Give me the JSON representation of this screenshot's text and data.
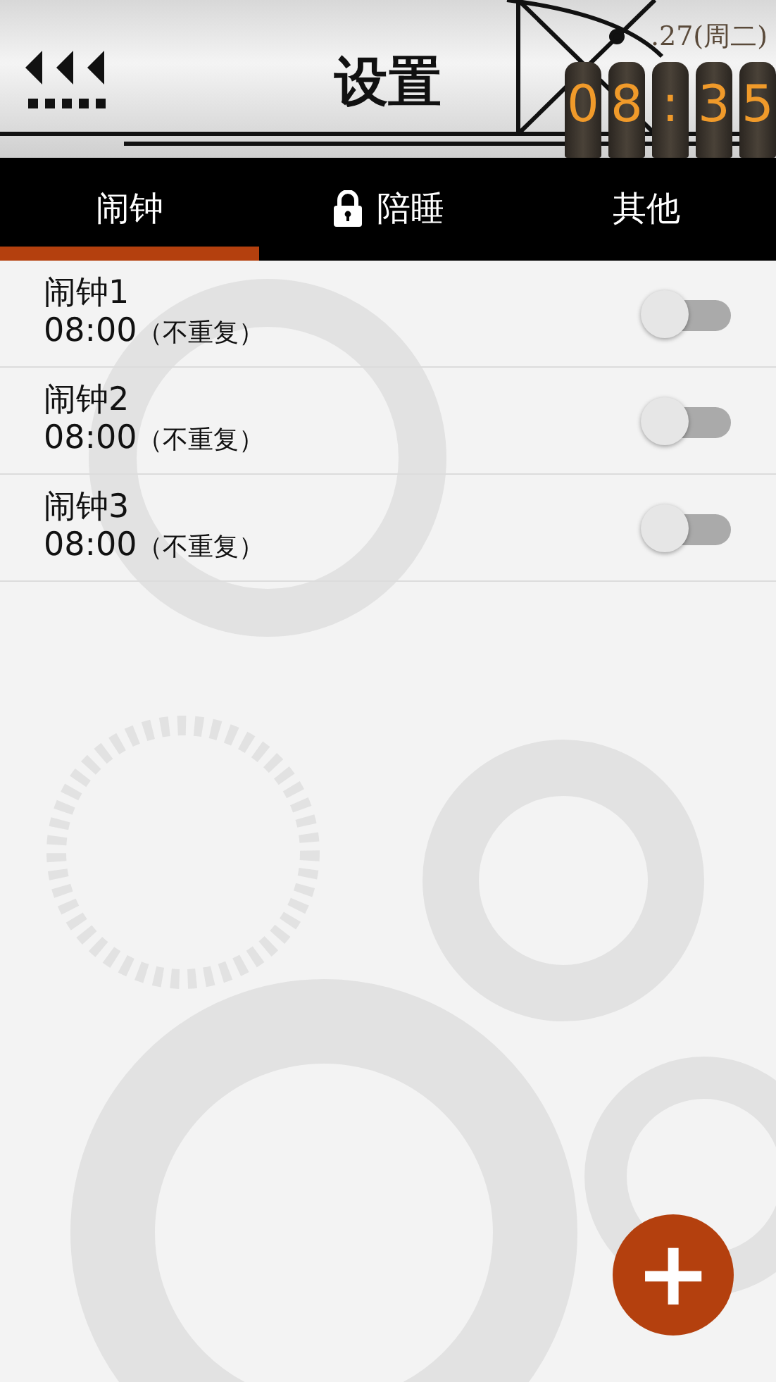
{
  "header": {
    "title": "设置",
    "date": ".27(周二)",
    "clock_digits": [
      "0",
      "8",
      ":",
      "3",
      "5"
    ]
  },
  "tabs": [
    {
      "label": "闹钟",
      "selected": true,
      "locked": false
    },
    {
      "label": "陪睡",
      "selected": false,
      "locked": true
    },
    {
      "label": "其他",
      "selected": false,
      "locked": false
    }
  ],
  "alarms": [
    {
      "name": "闹钟1",
      "time": "08:00",
      "repeat": "（不重复）",
      "on": false
    },
    {
      "name": "闹钟2",
      "time": "08:00",
      "repeat": "（不重复）",
      "on": false
    },
    {
      "name": "闹钟3",
      "time": "08:00",
      "repeat": "（不重复）",
      "on": false
    }
  ],
  "fab": {
    "symbol": "+"
  }
}
